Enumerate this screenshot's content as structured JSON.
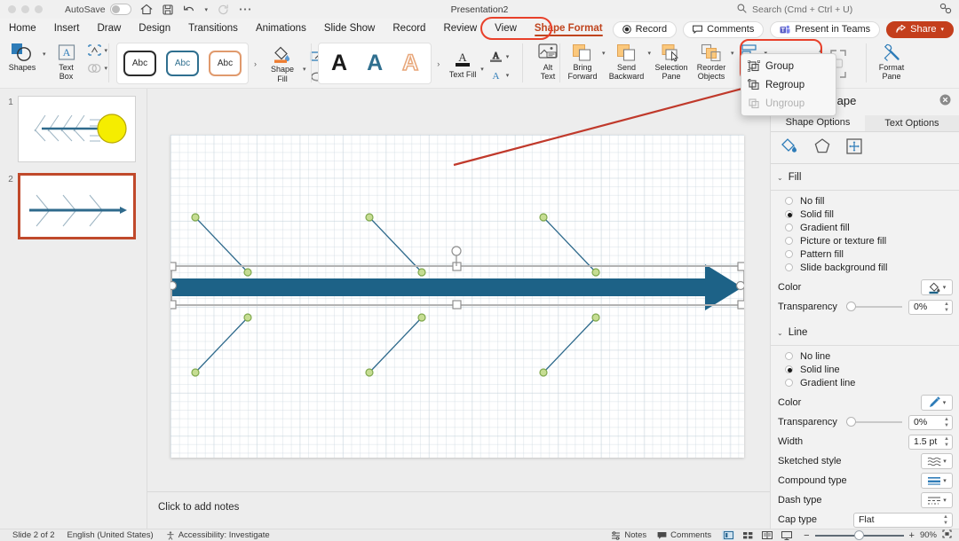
{
  "window": {
    "title": "Presentation2",
    "autosave_label": "AutoSave",
    "autosave_state": "off"
  },
  "search": {
    "placeholder": "Search (Cmd + Ctrl + U)"
  },
  "tabs": [
    {
      "label": "Home",
      "active": false
    },
    {
      "label": "Insert",
      "active": false
    },
    {
      "label": "Draw",
      "active": false
    },
    {
      "label": "Design",
      "active": false
    },
    {
      "label": "Transitions",
      "active": false
    },
    {
      "label": "Animations",
      "active": false
    },
    {
      "label": "Slide Show",
      "active": false
    },
    {
      "label": "Record",
      "active": false
    },
    {
      "label": "Review",
      "active": false
    },
    {
      "label": "View",
      "active": false
    },
    {
      "label": "Shape Format",
      "active": true
    }
  ],
  "tabbar_right": {
    "record": "Record",
    "comments": "Comments",
    "present_in_teams": "Present in Teams",
    "share": "Share"
  },
  "ribbon": {
    "shapes": "Shapes",
    "text_box": "Text\nBox",
    "text_box_l1": "Text",
    "text_box_l2": "Box",
    "shape_styles": [
      {
        "text": "Abc",
        "style": "dark"
      },
      {
        "text": "Abc",
        "style": "blue"
      },
      {
        "text": "Abc",
        "style": "orange"
      }
    ],
    "shape_fill_l1": "Shape",
    "shape_fill_l2": "Fill",
    "wordart_styles": [
      "A",
      "A",
      "A"
    ],
    "text_fill": "Text Fill",
    "alt_text_l1": "Alt",
    "alt_text_l2": "Text",
    "bring_forward_l1": "Bring",
    "bring_forward_l2": "Forward",
    "send_backward_l1": "Send",
    "send_backward_l2": "Backward",
    "selection_pane_l1": "Selection",
    "selection_pane_l2": "Pane",
    "reorder_objects_l1": "Reorder",
    "reorder_objects_l2": "Objects",
    "align": "Align",
    "format_pane_l1": "Format",
    "format_pane_l2": "Pane"
  },
  "group_menu": {
    "open": true,
    "items": [
      {
        "label": "Group",
        "disabled": false
      },
      {
        "label": "Regroup",
        "disabled": false
      },
      {
        "label": "Ungroup",
        "disabled": true
      }
    ]
  },
  "thumbnails": [
    {
      "number": "1",
      "active": false
    },
    {
      "number": "2",
      "active": true
    }
  ],
  "notes": {
    "placeholder": "Click to add notes"
  },
  "format_pane": {
    "title": "Format Shape",
    "tabs": [
      {
        "label": "Shape Options",
        "active": true
      },
      {
        "label": "Text Options",
        "active": false
      }
    ],
    "fill": {
      "section": "Fill",
      "options": [
        {
          "label": "No fill",
          "selected": false
        },
        {
          "label": "Solid fill",
          "selected": true
        },
        {
          "label": "Gradient fill",
          "selected": false
        },
        {
          "label": "Picture or texture fill",
          "selected": false
        },
        {
          "label": "Pattern fill",
          "selected": false
        },
        {
          "label": "Slide background fill",
          "selected": false
        }
      ],
      "color_label": "Color",
      "color_value": "#1d6287",
      "transparency_label": "Transparency",
      "transparency_value": "0%"
    },
    "line": {
      "section": "Line",
      "options": [
        {
          "label": "No line",
          "selected": false
        },
        {
          "label": "Solid line",
          "selected": true
        },
        {
          "label": "Gradient line",
          "selected": false
        }
      ],
      "color_label": "Color",
      "transparency_label": "Transparency",
      "transparency_value": "0%",
      "width_label": "Width",
      "width_value": "1.5 pt",
      "sketched_style_label": "Sketched style",
      "compound_type_label": "Compound type",
      "dash_type_label": "Dash type",
      "cap_type_label": "Cap type",
      "cap_type_value": "Flat"
    }
  },
  "status_bar": {
    "slide_counter": "Slide 2 of 2",
    "language": "English (United States)",
    "accessibility": "Accessibility: Investigate",
    "notes": "Notes",
    "comments": "Comments",
    "zoom_level": "90%"
  },
  "slide_content": {
    "accent_color": "#1d6287",
    "bone_color": "#2f6a8c",
    "selected_shape": "spine-arrow",
    "annotation_arrow_color": "#c0392b"
  }
}
